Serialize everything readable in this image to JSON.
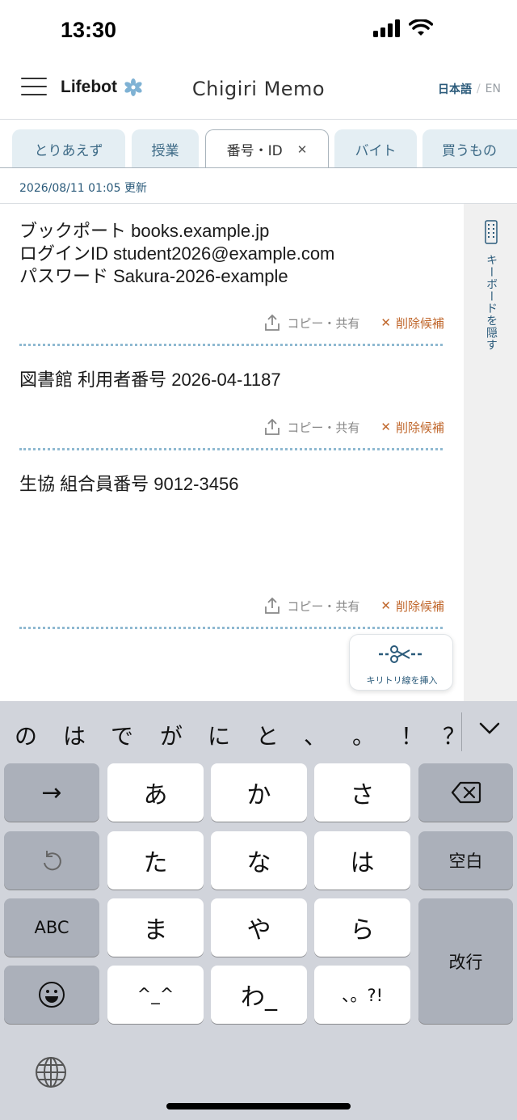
{
  "status_bar": {
    "time": "13:30"
  },
  "header": {
    "brand": "Lifebot",
    "title": "Chigiri Memo",
    "lang_active": "日本語",
    "lang_separator": "/",
    "lang_inactive": "EN"
  },
  "tabs": [
    {
      "label": "とりあえず"
    },
    {
      "label": "授業"
    },
    {
      "label": "番号・ID",
      "close": "✕"
    },
    {
      "label": "バイト"
    },
    {
      "label": "買うもの"
    }
  ],
  "update_text": "2026/08/11 01:05 更新",
  "memos": [
    {
      "text": "ブックポート books.example.jp\nログインID student2026@example.com\nパスワード Sakura-2026-example"
    },
    {
      "text": "図書館 利用者番号 2026-04-1187"
    },
    {
      "text": "生協 組合員番号 9012-3456"
    }
  ],
  "memo_actions": {
    "copy_share": "コピー・共有",
    "delete": "削除候補",
    "delete_mark": "✕"
  },
  "side_panel": {
    "hide_keyboard": "キーボードを隠す"
  },
  "cut_button": {
    "label": "キリトリ線を挿入"
  },
  "keyboard": {
    "suggestions": [
      "の",
      "は",
      "で",
      "が",
      "に",
      "と",
      "、",
      "。",
      "！",
      "？"
    ],
    "keys": {
      "arrow": "→",
      "a": "あ",
      "ka": "か",
      "sa": "さ",
      "ta": "た",
      "na": "な",
      "ha": "は",
      "abc": "ABC",
      "ma": "ま",
      "ya": "や",
      "ra": "ら",
      "kaomoji": "^_^",
      "wa": "わ_",
      "punct": "、。?!",
      "space": "空白",
      "enter": "改行"
    }
  },
  "colors": {
    "accent": "#2a5a7a",
    "delete": "#c0672c",
    "tab_bg": "#e4eef3",
    "dotted": "#8fb9d1"
  }
}
